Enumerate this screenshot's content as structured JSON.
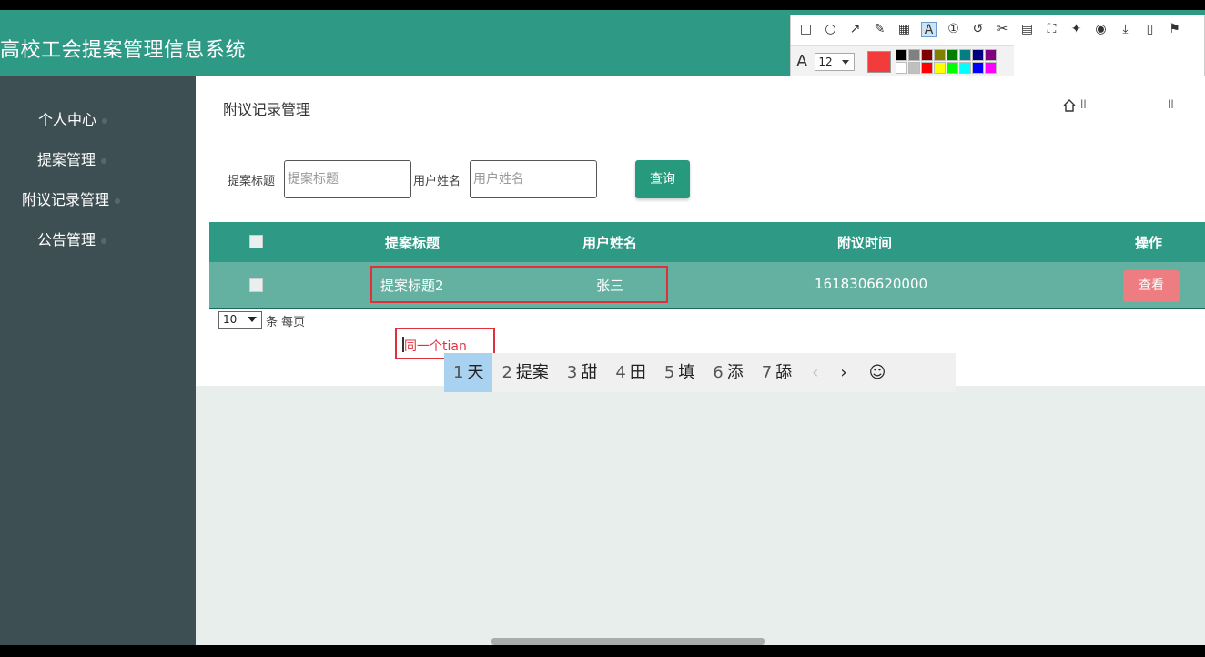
{
  "app": {
    "title": "高校工会提案管理信息系统"
  },
  "sidebar": {
    "items": [
      {
        "label": "个人中心"
      },
      {
        "label": "提案管理"
      },
      {
        "label": "附议记录管理"
      },
      {
        "label": "公告管理"
      }
    ]
  },
  "page": {
    "title": "附议记录管理",
    "breadcrumb_sep": "ll"
  },
  "search": {
    "title_label": "提案标题",
    "title_placeholder": "提案标题",
    "user_label": "用户姓名",
    "user_placeholder": "用户姓名",
    "query_label": "查询"
  },
  "table": {
    "columns": [
      "提案标题",
      "用户姓名",
      "附议时间",
      "操作"
    ],
    "rows": [
      {
        "title": "提案标题2",
        "user": "张三",
        "time": "1618306620000",
        "action": "查看"
      }
    ]
  },
  "pagination": {
    "page_size": "10",
    "unit": "条 每页"
  },
  "annotation_toolbar": {
    "font_size": "12",
    "current_color": "#f23c3c",
    "swatches": [
      "#000000",
      "#808080",
      "#800000",
      "#808000",
      "#008000",
      "#008080",
      "#000080",
      "#800080",
      "#ffffff",
      "#c0c0c0",
      "#ff0000",
      "#ffff00",
      "#00ff00",
      "#00ffff",
      "#0000ff",
      "#ff00ff"
    ]
  },
  "ime": {
    "composition": "同一个tian",
    "candidates": [
      {
        "n": "1",
        "text": "天"
      },
      {
        "n": "2",
        "text": "提案"
      },
      {
        "n": "3",
        "text": "甜"
      },
      {
        "n": "4",
        "text": "田"
      },
      {
        "n": "5",
        "text": "填"
      },
      {
        "n": "6",
        "text": "添"
      },
      {
        "n": "7",
        "text": "舔"
      }
    ],
    "prev": "‹",
    "next": "›",
    "emoji": "☺"
  },
  "colors": {
    "header": "#2e9a86",
    "sidebar": "#3e4f54",
    "view_button": "#ee7d82"
  }
}
